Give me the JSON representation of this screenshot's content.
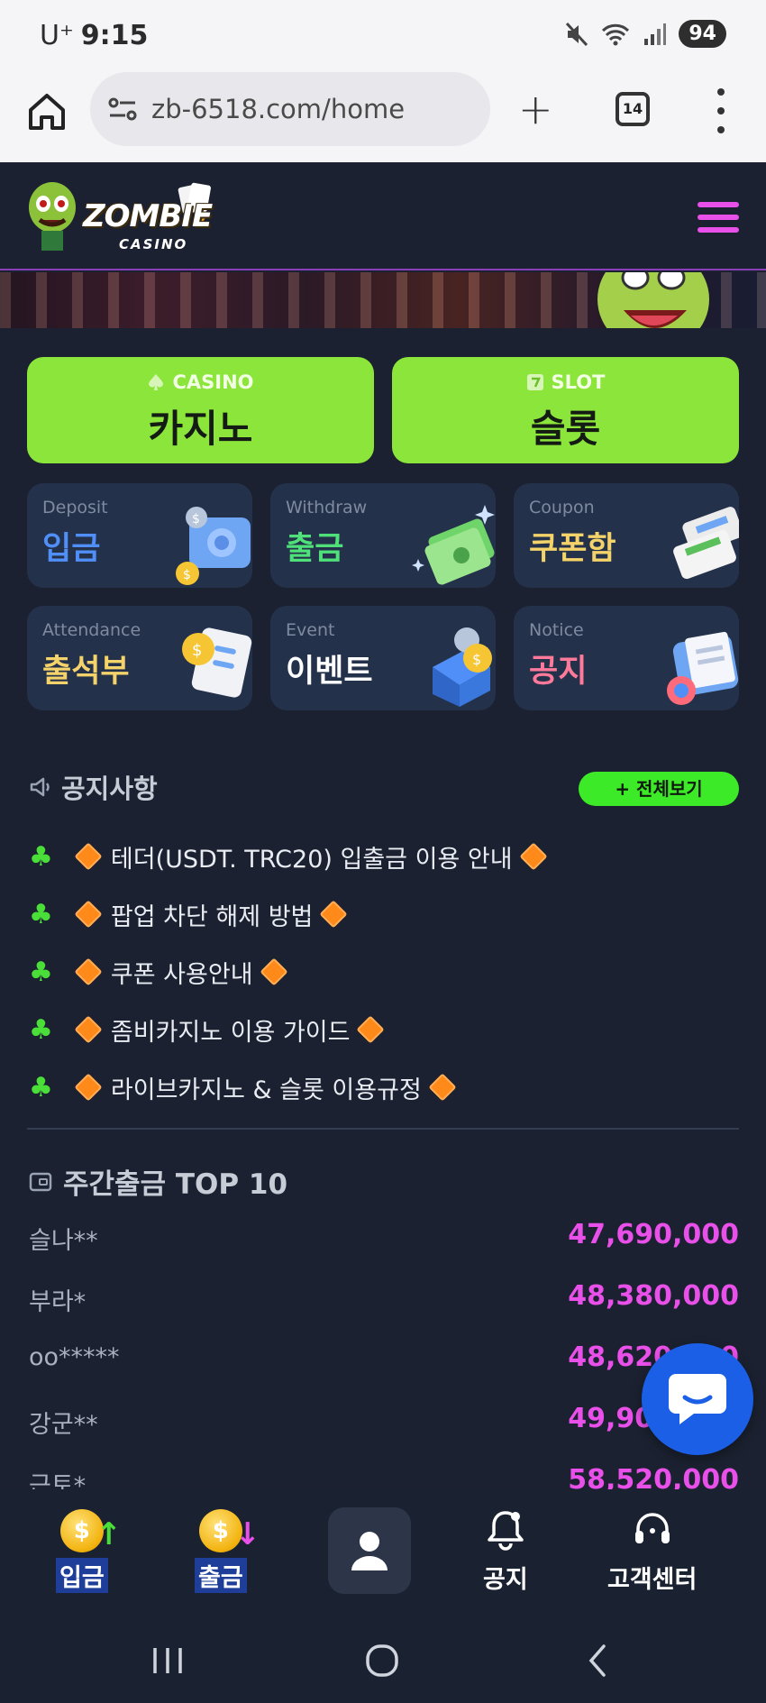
{
  "status_bar": {
    "carrier": "U⁺",
    "time": "9:15",
    "battery": "94"
  },
  "browser": {
    "url": "zb-6518.com/home",
    "tab_count": "14"
  },
  "site": {
    "logo_text": "ZOMBIE",
    "logo_sub": "CASINO"
  },
  "main_buttons": [
    {
      "sub": "CASINO",
      "label": "카지노"
    },
    {
      "sub": "SLOT",
      "label": "슬롯"
    }
  ],
  "tiles": [
    {
      "en": "Deposit",
      "ko": "입금",
      "color": "#4f8ff7"
    },
    {
      "en": "Withdraw",
      "ko": "출금",
      "color": "#4fe07a"
    },
    {
      "en": "Coupon",
      "ko": "쿠폰함",
      "color": "#f4d36a"
    },
    {
      "en": "Attendance",
      "ko": "출석부",
      "color": "#f4d36a"
    },
    {
      "en": "Event",
      "ko": "이벤트",
      "color": "#ffffff"
    },
    {
      "en": "Notice",
      "ko": "공지",
      "color": "#ff7a9a"
    }
  ],
  "notice": {
    "title": "공지사항",
    "view_all": "+ 전체보기",
    "items": [
      "테더(USDT. TRC20) 입출금 이용 안내",
      "팝업 차단 해제 방법",
      "쿠폰 사용안내",
      "좀비카지노 이용 가이드",
      "라이브카지노 & 슬롯 이용규정"
    ]
  },
  "top10": {
    "title": "주간출금 TOP 10",
    "rows": [
      {
        "name": "슬나**",
        "amount": "47,690,000"
      },
      {
        "name": "부라*",
        "amount": "48,380,000"
      },
      {
        "name": "oo*****",
        "amount": "48,620,000"
      },
      {
        "name": "강군**",
        "amount": "49,900,000"
      },
      {
        "name": "근토*",
        "amount": "58,520,000"
      }
    ]
  },
  "bottom_nav": {
    "deposit": "입금",
    "withdraw": "출금",
    "notice": "공지",
    "support": "고객센터"
  },
  "colors": {
    "accent_green": "#8ce53a",
    "accent_pink": "#e94fe9",
    "bg": "#1b2130",
    "chat_blue": "#1b5fe7"
  }
}
